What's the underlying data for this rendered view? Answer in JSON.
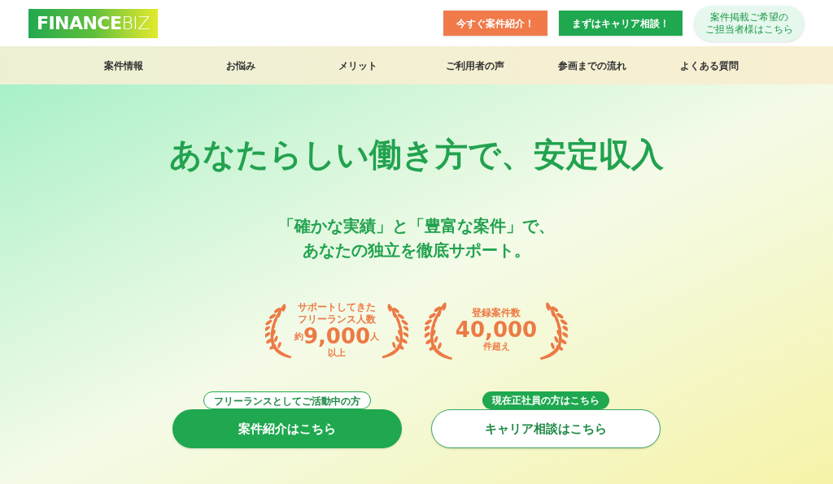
{
  "header": {
    "logo": {
      "part_1": "FINANCE",
      "part_2": "BIZ"
    },
    "buttons": [
      {
        "label": "今すぐ案件紹介！",
        "kind": "orange"
      },
      {
        "label": "まずはキャリア相談！",
        "kind": "green"
      },
      {
        "lines": [
          "案件掲載ご希望の",
          "ご担当者様はこちら"
        ],
        "kind": "pale"
      }
    ]
  },
  "nav": [
    "案件情報",
    "お悩み",
    "メリット",
    "ご利用者の声",
    "参画までの流れ",
    "よくある質問"
  ],
  "hero": {
    "headline": "あなたらしい働き方で、安定収入",
    "subline": [
      "「確かな実績」と「豊富な案件」で、",
      "あなたの独立を徹底サポート。"
    ],
    "stats": [
      {
        "caption": [
          "サポートしてきた",
          "フリーランス人数"
        ],
        "prefix": "約",
        "number": "9,000",
        "suffix": "人",
        "note": "以上"
      },
      {
        "caption": [
          "登録案件数"
        ],
        "number": "40,000",
        "note": "件超え"
      }
    ],
    "ctas": [
      {
        "tag": "フリーランスとしてご活動中の方",
        "label": "案件紹介はこちら",
        "kind": "filled"
      },
      {
        "tag": "現在正社員の方はこちら",
        "label": "キャリア相談はこちら",
        "kind": "outline"
      }
    ]
  }
}
